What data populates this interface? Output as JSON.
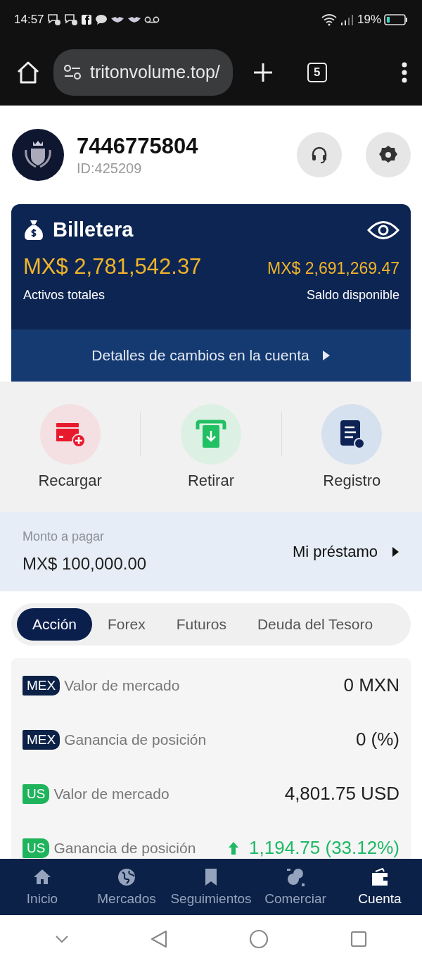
{
  "status_bar": {
    "time": "14:57",
    "battery": "19%"
  },
  "browser": {
    "url": "tritonvolume.top/",
    "tab_count": "5"
  },
  "profile": {
    "name": "7446775804",
    "id": "ID:425209"
  },
  "wallet": {
    "title": "Billetera",
    "total_amount": "MX$ 2,781,542.37",
    "total_label": "Activos totales",
    "available_amount": "MX$ 2,691,269.47",
    "available_label": "Saldo disponible",
    "details_link": "Detalles de cambios en la cuenta"
  },
  "actions": [
    {
      "kind": "recharge",
      "label": "Recargar"
    },
    {
      "kind": "withdraw",
      "label": "Retirar"
    },
    {
      "kind": "records",
      "label": "Registro"
    }
  ],
  "loan": {
    "label": "Monto a pagar",
    "amount": "MX$ 100,000.00",
    "link": "Mi préstamo"
  },
  "tabs": [
    {
      "label": "Acción",
      "selected": true
    },
    {
      "label": "Forex",
      "selected": false
    },
    {
      "label": "Futuros",
      "selected": false
    },
    {
      "label": "Deuda del Tesoro",
      "selected": false
    }
  ],
  "positions": [
    {
      "badge": "MEX",
      "color": "#0b2147",
      "label": "Valor de mercado",
      "value": "0 MXN",
      "rising": false
    },
    {
      "badge": "MEX",
      "color": "#0b2147",
      "label": "Ganancia de posición",
      "value": "0 (%)",
      "rising": false
    },
    {
      "badge": "US",
      "color": "#1fb35c",
      "label": "Valor de mercado",
      "value": "4,801.75 USD",
      "rising": false
    },
    {
      "badge": "US",
      "color": "#1fb35c",
      "label": "Ganancia de posición",
      "value": "1,194.75 (33.12%)",
      "rising": true
    }
  ],
  "nav": [
    {
      "kind": "home",
      "label": "Inicio",
      "selected": false
    },
    {
      "kind": "markets",
      "label": "Mercados",
      "selected": false
    },
    {
      "kind": "watchlist",
      "label": "Seguimientos",
      "selected": false
    },
    {
      "kind": "trade",
      "label": "Comerciar",
      "selected": false
    },
    {
      "kind": "account",
      "label": "Cuenta",
      "selected": true
    }
  ]
}
